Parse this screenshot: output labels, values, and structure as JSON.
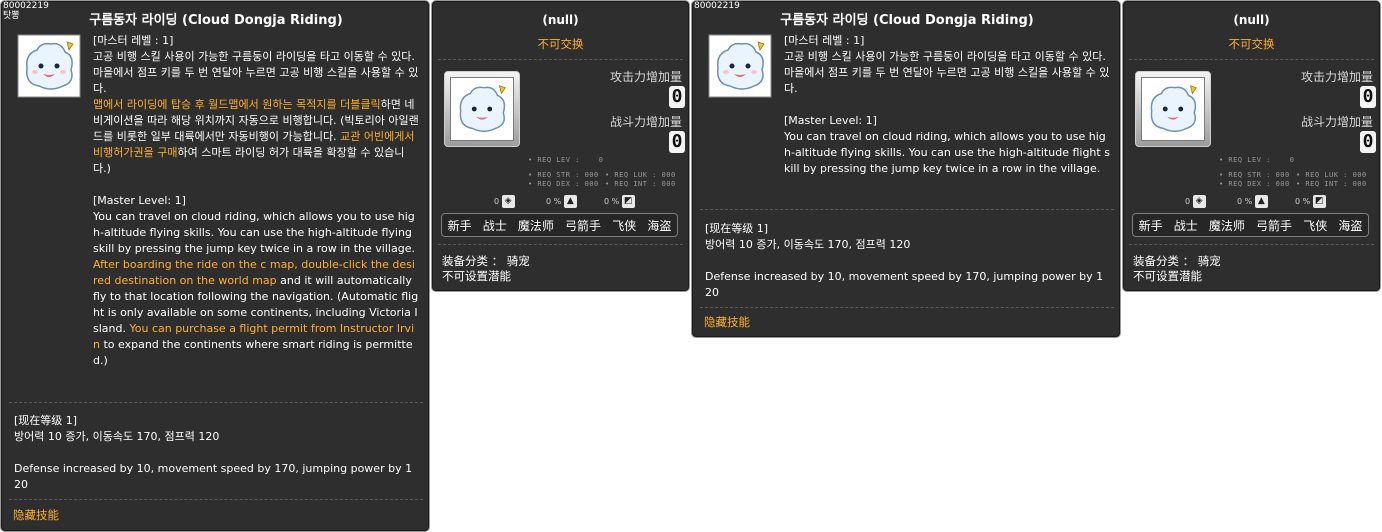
{
  "skill_id": "80002219",
  "skill_sub": "탓뽕",
  "skill_title": "구름동자 라이딩 (Cloud Dongja Riding)",
  "panel1": {
    "master_level_ko": "[마스터 레벨 : 1]",
    "desc_ko_1": "고공 비행 스킬 사용이 가능한 구름둥이 라이딩을 타고 이동할 수 있다. 마을에서 점프 키를 두 번 연달아 누르면 고공 비행 스킬을 사용할 수 있다.",
    "desc_ko_hl1": "맵에서 라이딩에 탑승 후 월드맵에서 원하는 목적지를 더블클릭",
    "desc_ko_2": "하면 네비게이션을 따라 해당 위치까지 자동으로 비행합니다. (빅토리아 아일랜드를 비롯한 일부 대륙에서만 자동비행이 가능합니다. ",
    "desc_ko_hl2": "교관 어빈에게서 비행허가권을 구매",
    "desc_ko_3": "하여 스마트 라이딩 허가 대륙을 확장할 수 있습니다.)",
    "master_level_en": "[Master Level: 1]",
    "desc_en_1": "You can travel on cloud riding, which allows you to use high-altitude flying skills. You can use the high-altitude flying skill by pressing the jump key twice in a row in the village.",
    "desc_en_hl1": "After boarding the ride on the c map, double-click the desired destination on the world map",
    "desc_en_2": " and it will automatically fly to that location following the navigation. (Automatic flight is only available on some continents, including Victoria Island. ",
    "desc_en_hl2": "You can purchase a flight permit from Instructor Irvin",
    "desc_en_3": " to expand the continents where smart riding is permitted.)",
    "current_level": "[现在等级 1]",
    "effect_ko": "방어력 10 증가, 이동속도 170, 점프력 120",
    "effect_en": "Defense increased by 10, movement speed by 170, jumping power by 120",
    "hidden_skill": "隐藏技能"
  },
  "panel2": {
    "title": "(null)",
    "untradable": "不可交换",
    "attack_label": "攻击力增加量",
    "attack_value": "0",
    "combat_label": "战斗力增加量",
    "combat_value": "0",
    "req_lev": "• REQ LEV :    0",
    "req_str": "• REQ STR : 000",
    "req_luk": "• REQ LUK : 000",
    "req_dex": "• REQ DEX : 000",
    "req_int": "• REQ INT : 000",
    "slot1": "0",
    "slot2": "0 %",
    "slot3": "0 %",
    "jobs": [
      "新手",
      "战士",
      "魔法师",
      "弓箭手",
      "飞侠",
      "海盗"
    ],
    "equip_category": "装备分类 ： 骑宠",
    "no_potential": "不可设置潜能"
  },
  "panel3": {
    "master_level_ko": "[마스터 레벨 : 1]",
    "desc_ko": "고공 비행 스킬 사용이 가능한 구름둥이 라이딩을 타고 이동할 수 있다. 마을에서 점프 키를 두 번 연달아 누르면 고공 비행 스킬을 사용할 수 있다.",
    "master_level_en": "[Master Level: 1]",
    "desc_en": "You can travel on cloud riding, which allows you to use high-altitude flying skills. You can use the high-altitude flight skill by pressing the jump key twice in a row in the village.",
    "current_level": "[现在等级 1]",
    "effect_ko": "방어력 10 증가, 이동속도 170, 점프력 120",
    "effect_en": "Defense increased by 10, movement speed by 170, jumping power by 120",
    "hidden_skill": "隐藏技能"
  },
  "colors": {
    "panel_bg": "#2e2e2e",
    "highlight": "#ffb02e",
    "border": "#9a9a9a"
  },
  "icons": [
    "cloud-dongja-icon",
    "pendant-icon",
    "shield-icon",
    "glove-icon"
  ]
}
